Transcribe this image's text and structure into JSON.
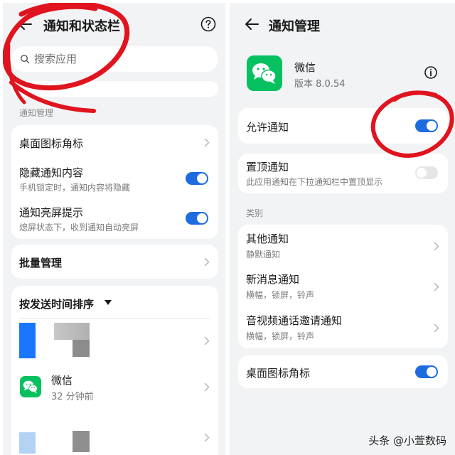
{
  "left": {
    "header": {
      "title": "通知和状态栏"
    },
    "search": {
      "placeholder": "搜索应用"
    },
    "section_label": "通知管理",
    "settings": [
      {
        "title": "桌面图标角标",
        "control": "chevron"
      },
      {
        "title": "隐藏通知内容",
        "subtitle": "手机锁定时，通知内容将隐藏",
        "control": "toggle",
        "on": true
      },
      {
        "title": "通知亮屏提示",
        "subtitle": "熄屏状态下，收到通知自动亮屏",
        "control": "toggle",
        "on": true
      }
    ],
    "batch": {
      "title": "批量管理"
    },
    "apps": {
      "sort_label": "按发送时间排序",
      "wechat": {
        "name": "微信",
        "time": "32 分钟前"
      }
    }
  },
  "right": {
    "header": {
      "title": "通知管理"
    },
    "app": {
      "name": "微信",
      "version": "版本 8.0.54"
    },
    "allow": {
      "title": "允许通知",
      "on": true
    },
    "pin": {
      "title": "置顶通知",
      "subtitle": "此应用通知在下拉通知栏中置顶显示",
      "on": false
    },
    "category_label": "类别",
    "categories": [
      {
        "title": "其他通知",
        "subtitle": "静默通知"
      },
      {
        "title": "新消息通知",
        "subtitle": "横幅，锁屏，铃声"
      },
      {
        "title": "音视频通话邀请通知",
        "subtitle": "横幅，锁屏，铃声"
      }
    ],
    "badge": {
      "title": "桌面图标角标",
      "on": true
    }
  },
  "watermark": "头条 @小萱数码",
  "colors": {
    "accent": "#1e6be0",
    "wechat": "#07c160",
    "annotation": "#e0141e"
  }
}
